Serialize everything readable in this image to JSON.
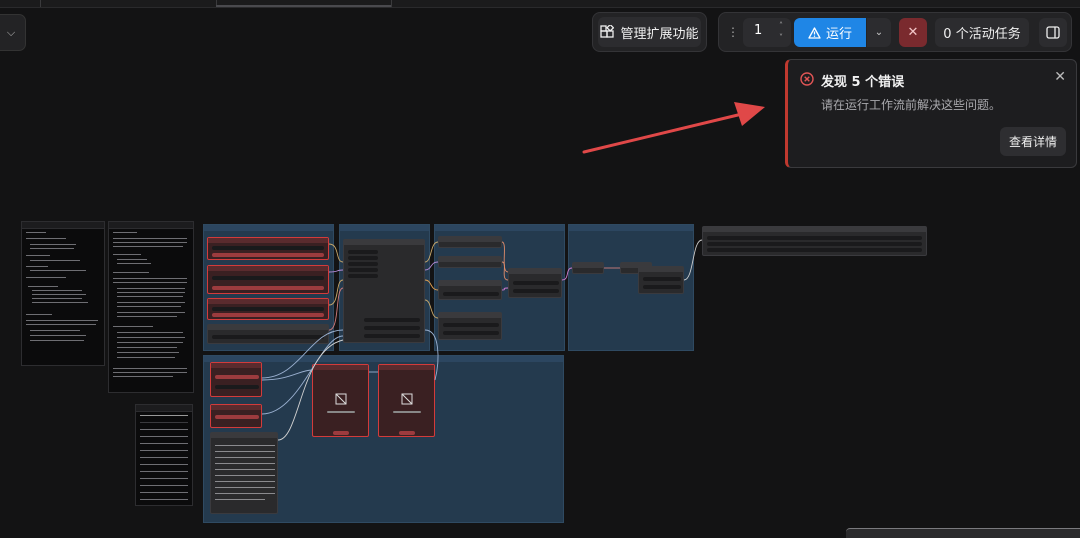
{
  "toolbar": {
    "manage_extensions": "管理扩展功能",
    "queue_count": "1",
    "run_label": "运行",
    "active_tasks": "0 个活动任务"
  },
  "toast": {
    "title": "发现 5 个错误",
    "message": "请在运行工作流前解决这些问题。",
    "details_button": "查看详情"
  },
  "colors": {
    "run_blue": "#1f86e6",
    "error_red": "#d33b3b",
    "group_blue": "#243a4e",
    "arrow_red": "#e04848"
  },
  "icons": [
    "chevron-down-icon",
    "extensions-icon",
    "drag-handle-icon",
    "warning-icon",
    "stop-icon",
    "panel-toggle-icon",
    "error-circle-icon",
    "close-icon",
    "image-missing-icon"
  ]
}
